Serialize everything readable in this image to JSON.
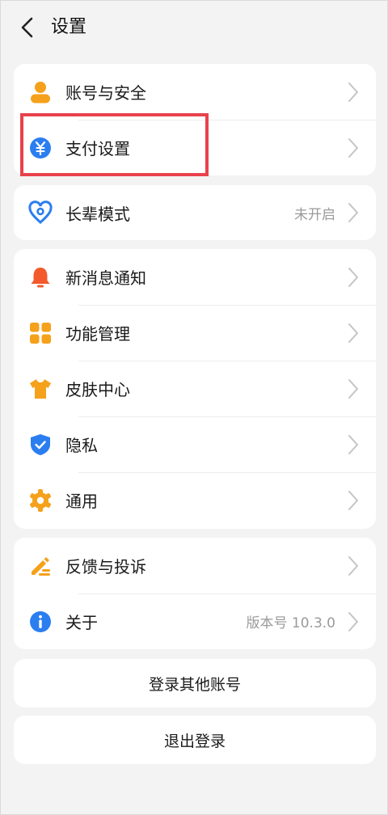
{
  "header": {
    "title": "设置"
  },
  "group1": [
    {
      "label": "账号与安全",
      "icon": "user-icon"
    },
    {
      "label": "支付设置",
      "icon": "yuan-icon"
    }
  ],
  "group2": [
    {
      "label": "长辈模式",
      "value": "未开启",
      "icon": "heart-location-icon"
    }
  ],
  "group3": [
    {
      "label": "新消息通知",
      "icon": "bell-icon"
    },
    {
      "label": "功能管理",
      "icon": "grid-icon"
    },
    {
      "label": "皮肤中心",
      "icon": "tshirt-icon"
    },
    {
      "label": "隐私",
      "icon": "shield-icon"
    },
    {
      "label": "通用",
      "icon": "gear-icon"
    }
  ],
  "group4": [
    {
      "label": "反馈与投诉",
      "icon": "pen-icon"
    },
    {
      "label": "关于",
      "value": "版本号 10.3.0",
      "icon": "info-icon"
    }
  ],
  "buttons": {
    "login_other": "登录其他账号",
    "logout": "退出登录"
  },
  "colors": {
    "orange": "#f5a11b",
    "blue": "#2b7ef0",
    "red_orange": "#f25a2c",
    "highlight": "#e8424c"
  }
}
